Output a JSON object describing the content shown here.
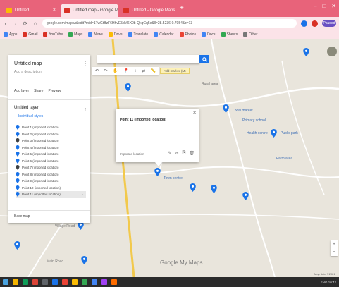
{
  "browser": {
    "tabs": [
      {
        "label": "Untitled",
        "color": "#fbbc05",
        "active": false
      },
      {
        "label": "Untitled map - Google My Maps",
        "color": "#d93025",
        "active": true
      },
      {
        "label": "Untitled - Google Maps",
        "color": "#d93025",
        "active": false
      }
    ],
    "new_tab_glyph": "+",
    "window_controls": [
      "–",
      "□",
      "✕"
    ],
    "address": "google.com/maps/d/edit?mid=1TwGtBzF6HhvE5dM6X0b-QkgCq5e&ll=28.5236-0.7954&z=13",
    "nav": [
      "‹",
      "›",
      "⟳",
      "⌂"
    ],
    "profile_label": "Paused",
    "bookmarks": [
      {
        "label": "Apps",
        "color": "#4285f4"
      },
      {
        "label": "Gmail",
        "color": "#d93025"
      },
      {
        "label": "YouTube",
        "color": "#d93025"
      },
      {
        "label": "Maps",
        "color": "#34a853"
      },
      {
        "label": "News",
        "color": "#4285f4"
      },
      {
        "label": "Drive",
        "color": "#fbbc05"
      },
      {
        "label": "Translate",
        "color": "#4285f4"
      },
      {
        "label": "Calendar",
        "color": "#4285f4"
      },
      {
        "label": "Photos",
        "color": "#ea4335"
      },
      {
        "label": "Docs",
        "color": "#4285f4"
      },
      {
        "label": "Sheets",
        "color": "#34a853"
      },
      {
        "label": "Other",
        "color": "#777777"
      }
    ]
  },
  "panel": {
    "title": "Untitled map",
    "subtitle": "Add a description",
    "actions": [
      "Add layer",
      "Share",
      "Preview"
    ],
    "layer_title": "Untitled layer",
    "style_label": "Individual styles",
    "items": [
      {
        "label": "Point 1 (imported location)",
        "color": "#1a73e8"
      },
      {
        "label": "Point 2 (imported location)",
        "color": "#1a73e8"
      },
      {
        "label": "Point 3 (imported location)",
        "color": "#3c4043"
      },
      {
        "label": "Point 4 (imported location)",
        "color": "#1a73e8"
      },
      {
        "label": "Point 5 (imported location)",
        "color": "#1a73e8"
      },
      {
        "label": "Point 6 (imported location)",
        "color": "#1a73e8"
      },
      {
        "label": "Point 7 (imported location)",
        "color": "#3c4043"
      },
      {
        "label": "Point 8 (imported location)",
        "color": "#1a73e8"
      },
      {
        "label": "Point 9 (imported location)",
        "color": "#1a73e8"
      },
      {
        "label": "Point 10 (imported location)",
        "color": "#1a73e8"
      },
      {
        "label": "Point 11 (imported location)",
        "color": "#1a73e8"
      }
    ],
    "selected_index": 10,
    "basemap_label": "Base map"
  },
  "search": {
    "placeholder": ""
  },
  "toolbar": {
    "tools": [
      "↶",
      "↷",
      "✋",
      "📍",
      "⌇",
      "⇄",
      "📏"
    ]
  },
  "tooltip": "Add marker (M)",
  "infowindow": {
    "title": "Point 11 (imported location)",
    "footer": "Imported location",
    "tools": [
      "✎",
      "✂",
      "⎘",
      "🗑"
    ],
    "close": "✕"
  },
  "map_labels": [
    {
      "text": "Village Road",
      "blue": false
    },
    {
      "text": "Rural area",
      "blue": false
    },
    {
      "text": "Local market",
      "blue": true
    },
    {
      "text": "Primary school",
      "blue": true
    },
    {
      "text": "Health centre",
      "blue": true
    },
    {
      "text": "Public park",
      "blue": true
    },
    {
      "text": "Farm area",
      "blue": true
    },
    {
      "text": "Town centre",
      "blue": true
    },
    {
      "text": "Main Road",
      "blue": false
    }
  ],
  "logo": "Google My Maps",
  "zoom": [
    "+",
    "−"
  ],
  "terms": "Map data ©2021",
  "taskbar": {
    "icons": [
      "#4aa3df",
      "#f4b400",
      "#0f9d58",
      "#db4437",
      "#5f6368",
      "#1a73e8",
      "#ea4335",
      "#fbbc05",
      "#34a853",
      "#4285f4",
      "#a142f4",
      "#ff6d00"
    ],
    "tray": "ENG  10:42"
  }
}
